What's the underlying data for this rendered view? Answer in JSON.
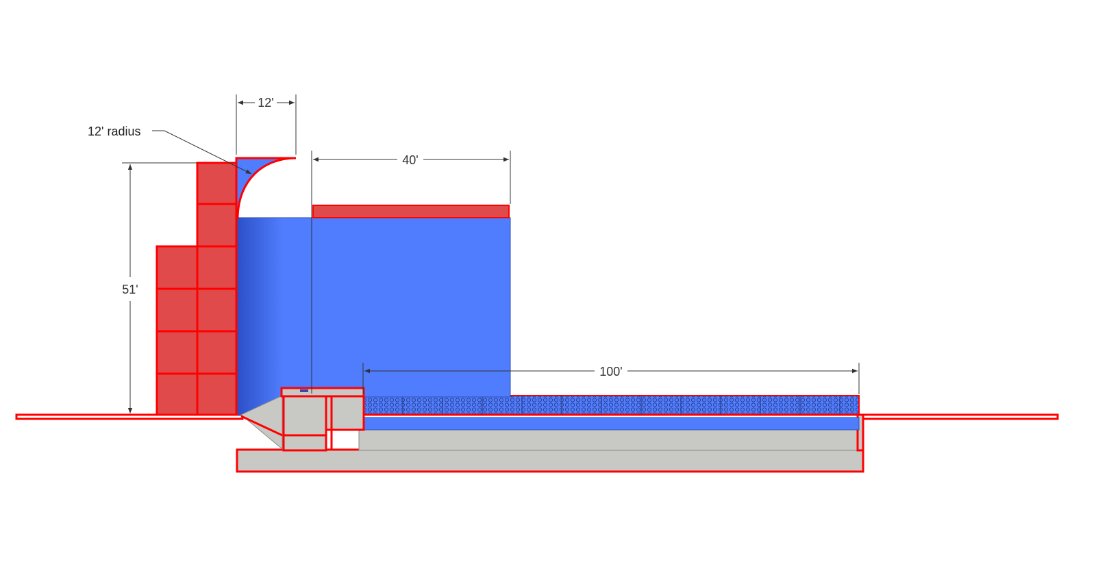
{
  "diagram": {
    "labels": {
      "radius_callout": "12' radius",
      "dim_top_width": "12'",
      "dim_wall_height": "51'",
      "dim_reservoir_width": "40'",
      "dim_pool_length": "100'"
    },
    "colors": {
      "red_outline": "#ff0000",
      "block_fill": "#e04a4a",
      "water_blue": "#4f7dfd",
      "water_blue_dark": "#2f57d6",
      "concrete_grey": "#c8c8c4",
      "dimension_line": "#333333"
    }
  }
}
